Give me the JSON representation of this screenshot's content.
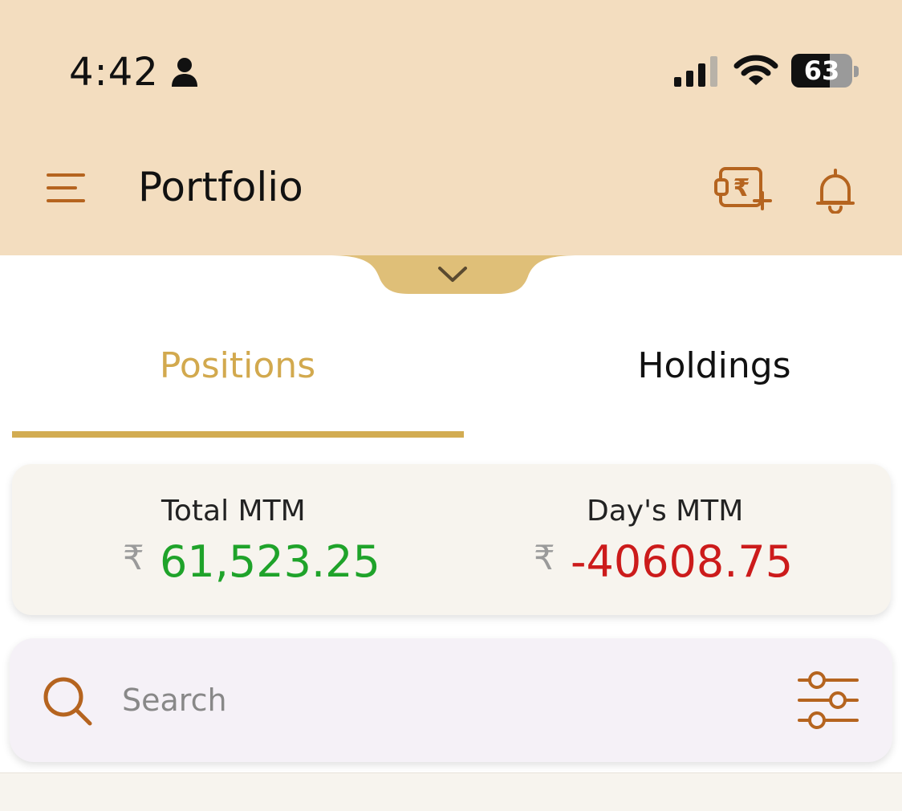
{
  "status_bar": {
    "time": "4:42",
    "battery": "63",
    "battery_percent": 63,
    "icons": [
      "person-icon",
      "cellular-signal-icon",
      "wifi-icon",
      "battery-icon"
    ]
  },
  "app_bar": {
    "title": "Portfolio",
    "icons": [
      "menu-icon",
      "add-funds-wallet-icon",
      "bell-icon",
      "chevron-down-icon"
    ]
  },
  "tabs": [
    {
      "label": "Positions",
      "active": true
    },
    {
      "label": "Holdings",
      "active": false
    }
  ],
  "mtm": {
    "currency_symbol": "₹",
    "total": {
      "label": "Total MTM",
      "value": "61,523.25"
    },
    "day": {
      "label": "Day's MTM",
      "value": "-40608.75"
    }
  },
  "search": {
    "placeholder": "Search",
    "value": "",
    "icons": [
      "search-icon",
      "filter-sliders-icon"
    ]
  },
  "colors": {
    "header_bg": "#f3ddbf",
    "accent": "#d2ac52",
    "icon_brown": "#b5641f",
    "positive": "#1fa32a",
    "negative": "#cc1b1b"
  }
}
